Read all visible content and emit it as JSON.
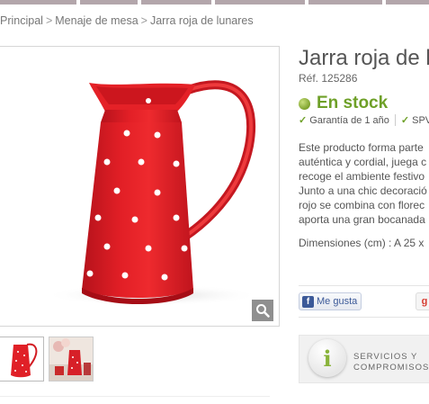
{
  "breadcrumb": {
    "items": [
      "Principal",
      "Menaje de mesa",
      "Jarra roja de lunares"
    ],
    "separator": ">"
  },
  "product": {
    "title": "Jarra roja de l",
    "ref": "Réf. 125286",
    "stock": "En stock",
    "features": [
      "Garantía de 1 año",
      "SPV"
    ],
    "description_lines": [
      "Este producto forma parte",
      "auténtica y cordial, juega c",
      "recoge el ambiente festivo",
      "Junto a una chic decoració",
      "rojo se combina con florec",
      "aporta una gran bocanada"
    ],
    "dimensions": "Dimensiones (cm) : A 25 x",
    "stock_color": "#6ea028"
  },
  "social": {
    "like_label": "Me gusta",
    "like_icon": "facebook-icon",
    "gplus_label": "g"
  },
  "services": {
    "line1": "SERVICIOS Y",
    "line2": "COMPROMISOS",
    "icon": "info-icon"
  },
  "gallery": {
    "zoom_icon": "magnifier-icon",
    "thumbnails": [
      "thumbnail-1",
      "thumbnail-2"
    ]
  }
}
